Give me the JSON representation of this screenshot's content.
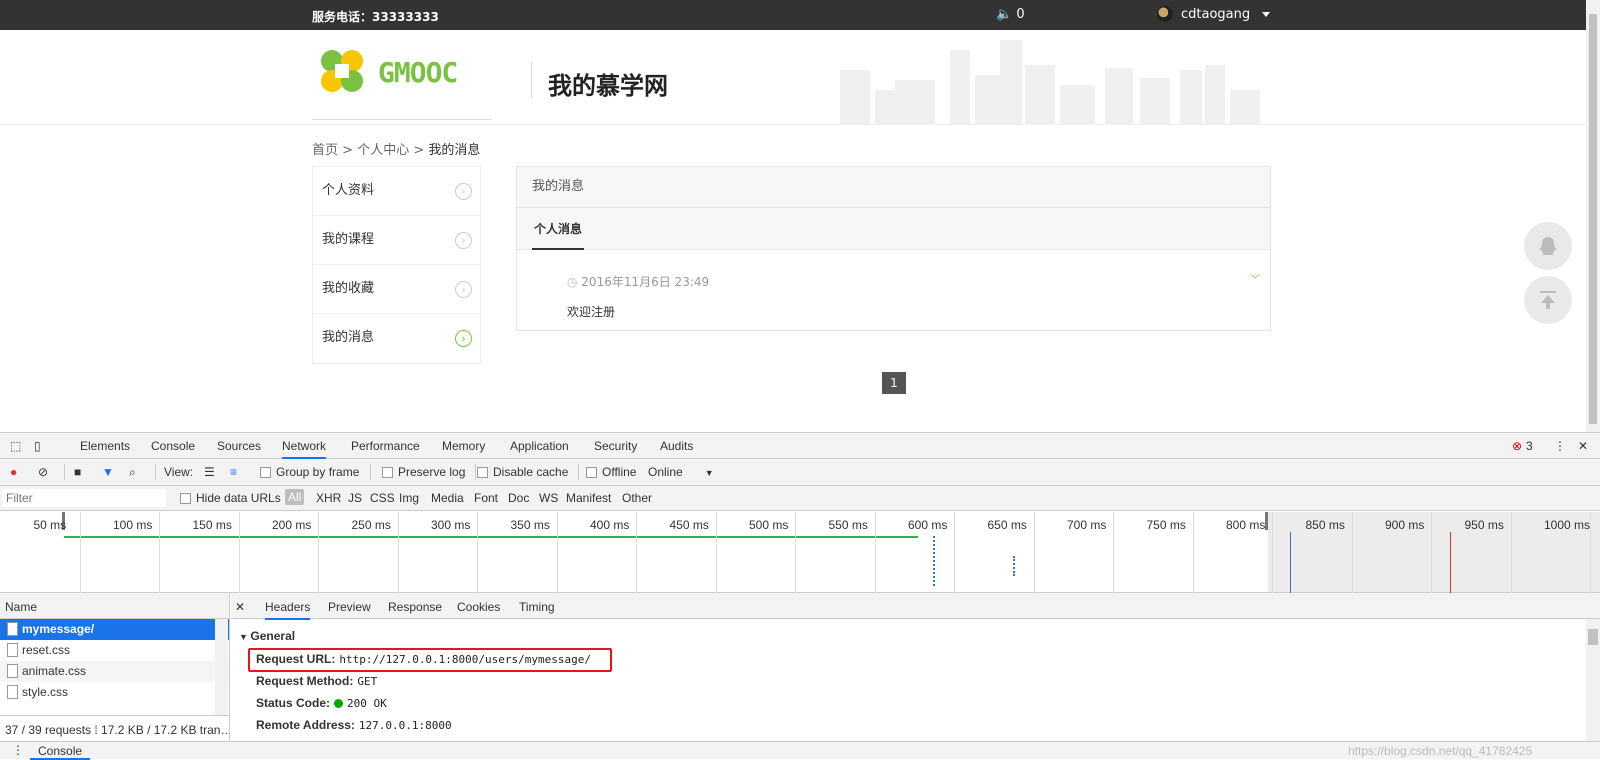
{
  "topbar": {
    "phone": "服务电话：33333333",
    "sound_count": "0",
    "username": "cdtaogang"
  },
  "header": {
    "logo_text": "GMOOC",
    "page_title": "我的慕学网"
  },
  "breadcrumb": {
    "home": "首页",
    "sep1": " > ",
    "center": "个人中心",
    "sep2": " > ",
    "current": "我的消息"
  },
  "leftnav": {
    "items": [
      {
        "label": "个人资料"
      },
      {
        "label": "我的课程"
      },
      {
        "label": "我的收藏"
      },
      {
        "label": "我的消息"
      }
    ]
  },
  "messages": {
    "panel_title": "我的消息",
    "tab_label": "个人消息",
    "item_time": "2016年11月6日 23:49",
    "item_body": "欢迎注册",
    "page_number": "1"
  },
  "devtools": {
    "tabs": [
      "Elements",
      "Console",
      "Sources",
      "Network",
      "Performance",
      "Memory",
      "Application",
      "Security",
      "Audits"
    ],
    "error_count": "3",
    "toolbar": {
      "view_label": "View:",
      "group_by_frame": "Group by frame",
      "preserve_log": "Preserve log",
      "disable_cache": "Disable cache",
      "offline": "Offline",
      "online": "Online"
    },
    "filter": {
      "placeholder": "Filter",
      "hide_data_urls": "Hide data URLs",
      "types": [
        "All",
        "XHR",
        "JS",
        "CSS",
        "Img",
        "Media",
        "Font",
        "Doc",
        "WS",
        "Manifest",
        "Other"
      ]
    },
    "timeline_ticks": [
      "50 ms",
      "100 ms",
      "150 ms",
      "200 ms",
      "250 ms",
      "300 ms",
      "350 ms",
      "400 ms",
      "450 ms",
      "500 ms",
      "550 ms",
      "600 ms",
      "650 ms",
      "700 ms",
      "750 ms",
      "800 ms",
      "850 ms",
      "900 ms",
      "950 ms",
      "1000 ms"
    ],
    "requests": {
      "header": "Name",
      "rows": [
        "mymessage/",
        "reset.css",
        "animate.css",
        "style.css"
      ],
      "status": "37 / 39 requests ⁞ 17.2 KB / 17.2 KB tran…"
    },
    "detail": {
      "tabs": [
        "Headers",
        "Preview",
        "Response",
        "Cookies",
        "Timing"
      ],
      "section": "General",
      "request_url_key": "Request URL:",
      "request_url": "http://127.0.0.1:8000/users/mymessage/",
      "request_method_key": "Request Method:",
      "request_method": "GET",
      "status_code_key": "Status Code:",
      "status_code": "200 OK",
      "remote_address_key": "Remote Address:",
      "remote_address": "127.0.0.1:8000"
    },
    "drawer": {
      "console_tab": "Console",
      "watermark": "https://blog.csdn.net/qq_41782425"
    }
  }
}
